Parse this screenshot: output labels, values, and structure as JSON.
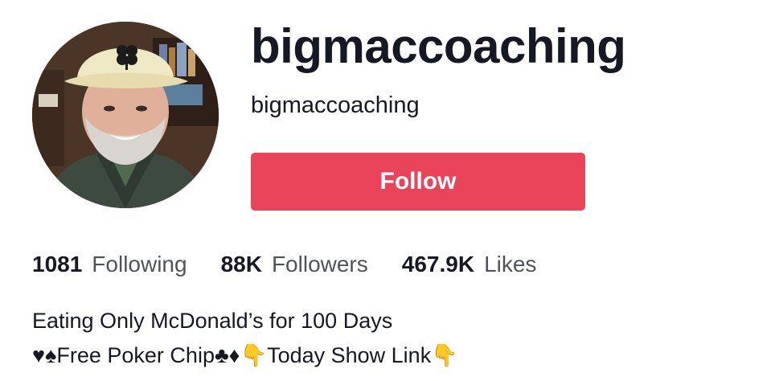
{
  "profile": {
    "display_name": "bigmaccoaching",
    "username": "bigmaccoaching",
    "follow_label": "Follow",
    "accent_color": "#ea445a"
  },
  "stats": {
    "following": {
      "value": "1081",
      "label": "Following"
    },
    "followers": {
      "value": "88K",
      "label": "Followers"
    },
    "likes": {
      "value": "467.9K",
      "label": "Likes"
    }
  },
  "bio": {
    "line1": "Eating Only McDonald’s for 100 Days",
    "line2": "♥♠Free Poker Chip♣♦👇Today Show Link👇"
  }
}
